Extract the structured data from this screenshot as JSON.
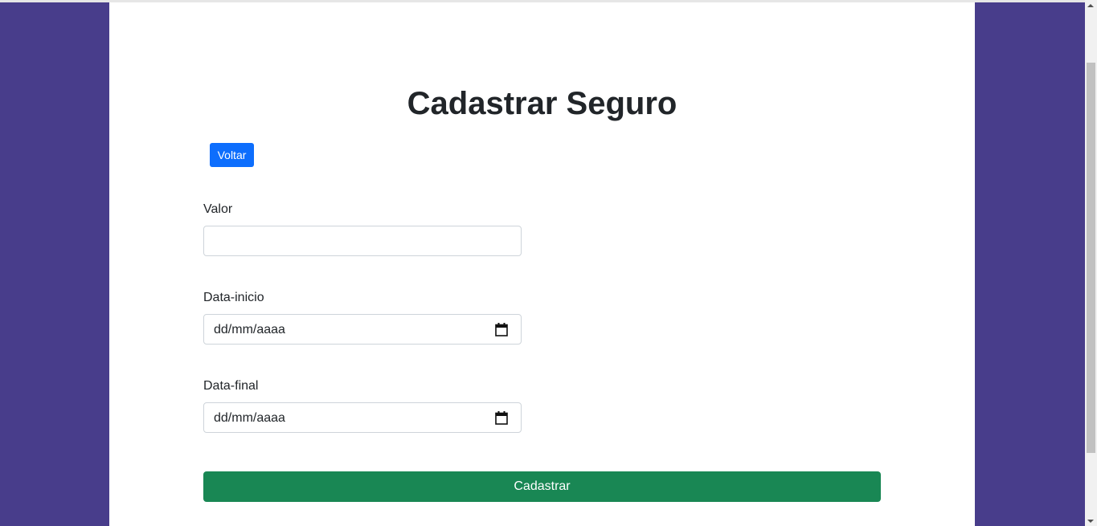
{
  "page": {
    "title": "Cadastrar Seguro",
    "back_button": "Voltar",
    "submit_button": "Cadastrar"
  },
  "form": {
    "valor": {
      "label": "Valor",
      "value": "",
      "placeholder": ""
    },
    "data_inicio": {
      "label": "Data-inicio",
      "value": "dd/mm/aaaa",
      "icon": "calendar-icon"
    },
    "data_final": {
      "label": "Data-final",
      "value": "dd/mm/aaaa",
      "icon": "calendar-icon"
    }
  },
  "colors": {
    "background": "#483d8b",
    "card": "#ffffff",
    "primary": "#0d6efd",
    "success": "#198754",
    "text": "#212529"
  }
}
